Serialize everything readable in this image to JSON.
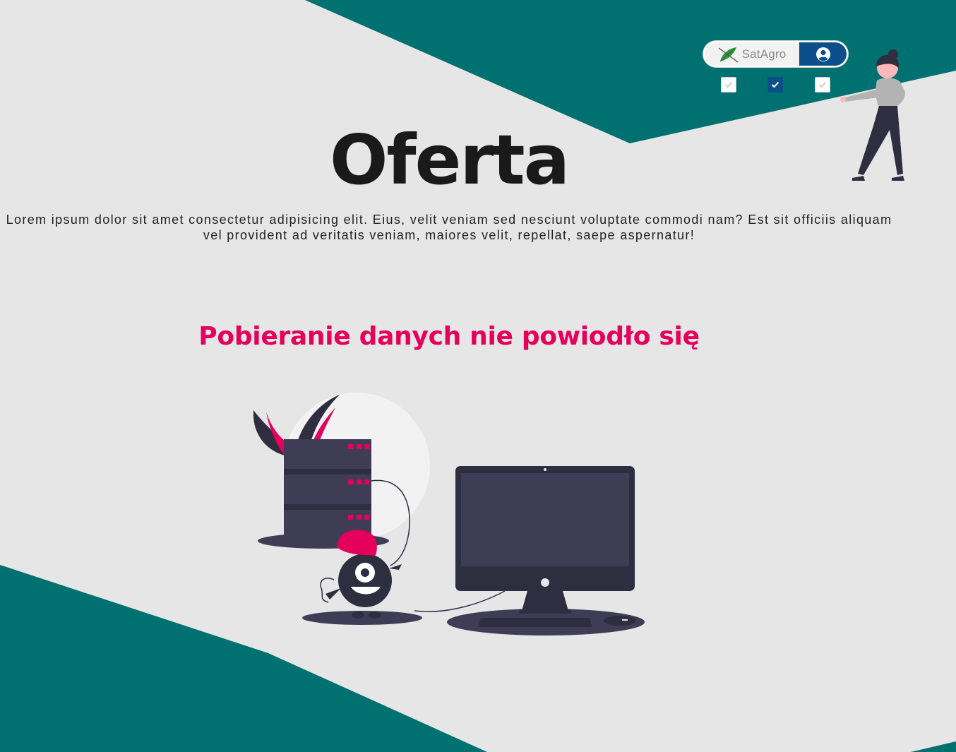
{
  "colors": {
    "background": "#e6e6e6",
    "teal": "#007070",
    "navy": "#0a4f8a",
    "error": "#e5005b",
    "dark": "#3f3d56"
  },
  "header": {
    "app_switcher": {
      "brand_label": "SatAgro",
      "account_icon": "user-circle-icon"
    },
    "checkboxes": [
      {
        "checked": false
      },
      {
        "checked": true
      },
      {
        "checked": false
      }
    ]
  },
  "main": {
    "title": "Oferta",
    "description": "Lorem ipsum dolor sit amet consectetur adipisicing elit. Eius, velit veniam sed nesciunt voluptate commodi nam? Est sit officiis aliquam vel provident ad veritatis veniam, maiores velit, repellat, saepe aspernatur!",
    "error_message": "Pobieranie danych nie powiodło się",
    "illustration": "server-down-illustration"
  },
  "decor": {
    "person_illustration": "woman-pointing-illustration"
  }
}
